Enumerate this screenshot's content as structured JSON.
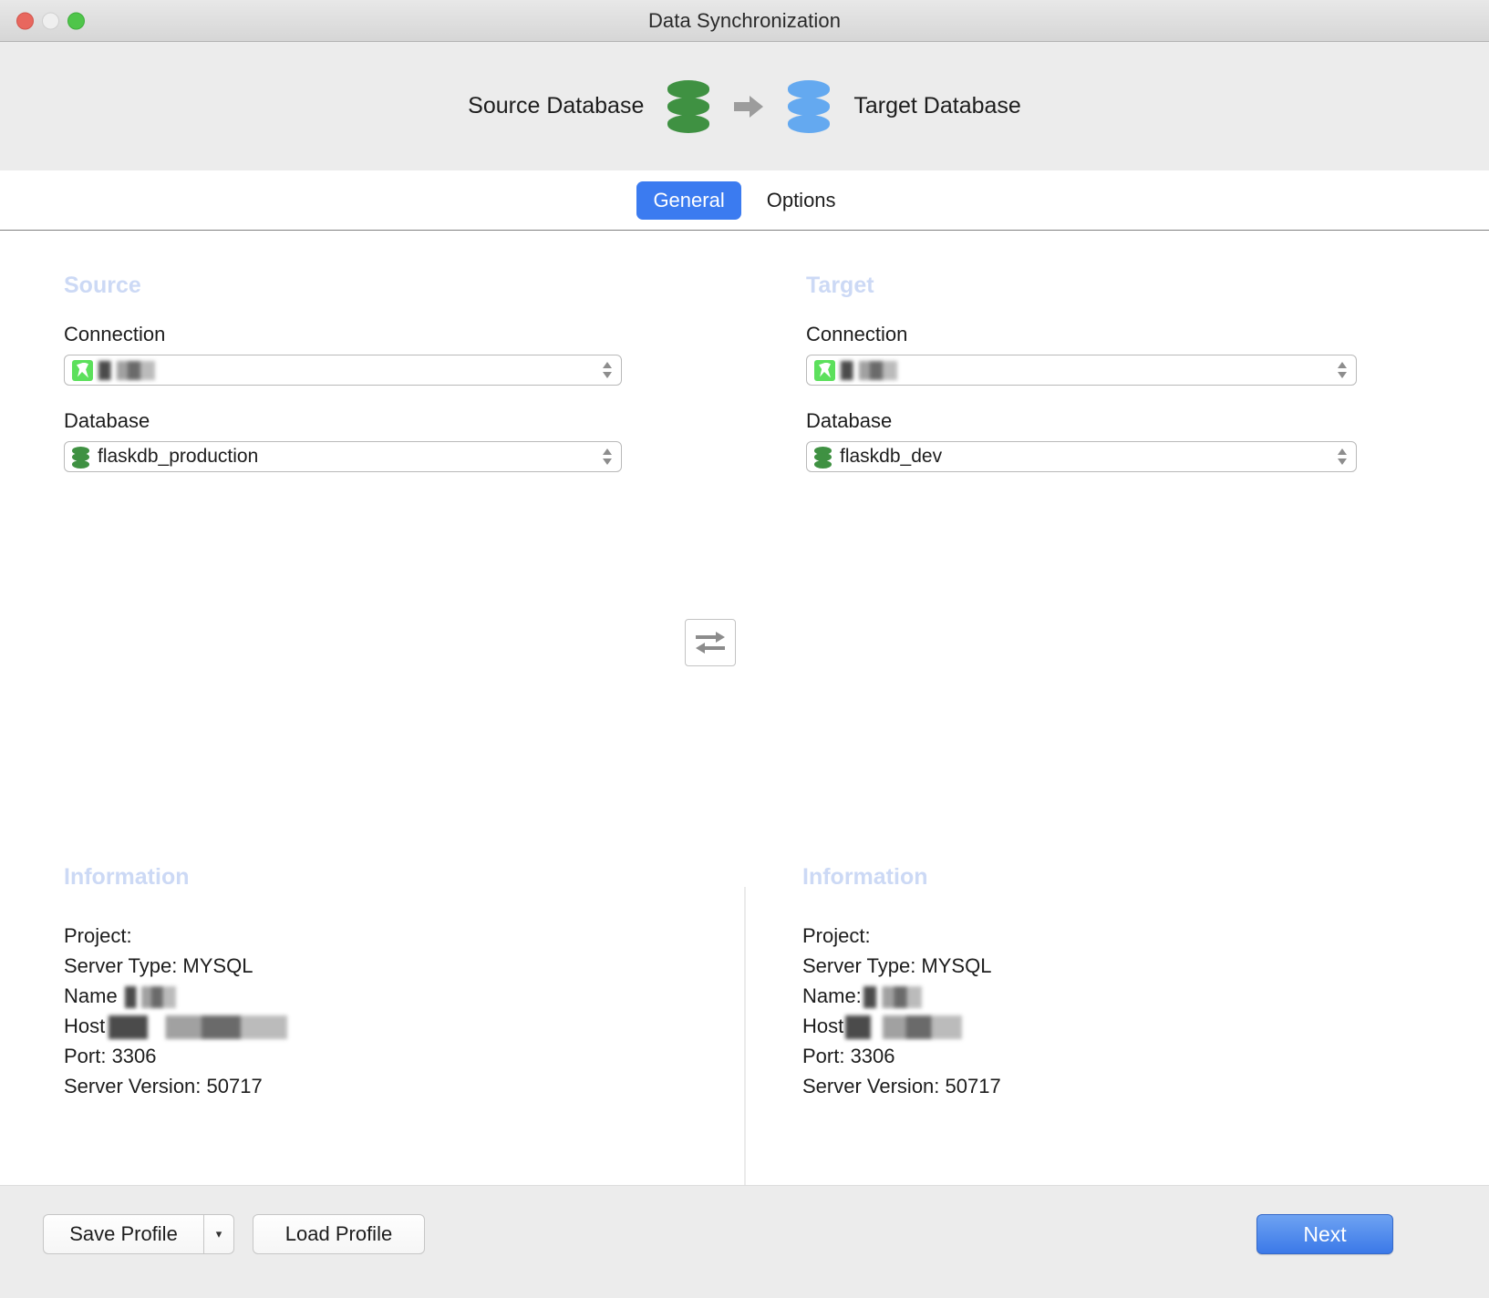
{
  "window": {
    "title": "Data Synchronization",
    "traffic_lights": [
      "close-button",
      "minimize-button",
      "zoom-button"
    ]
  },
  "hero": {
    "source_label": "Source Database",
    "target_label": "Target Database",
    "source_icon": "database-cylinder-icon",
    "arrow_icon": "right-arrow-icon",
    "target_icon": "database-cylinder-icon",
    "source_color": "#3f9142",
    "target_color": "#64a9f0",
    "arrow_color": "#9c9c9c"
  },
  "tabs": [
    {
      "label": "General",
      "active": true
    },
    {
      "label": "Options",
      "active": false
    }
  ],
  "tab_accent_color": "#3b7bf0",
  "source": {
    "section_title": "Source",
    "connection_label": "Connection",
    "connection_value": "",
    "connection_icon": "mysql-connection-icon",
    "database_label": "Database",
    "database_value": "flaskdb_production",
    "database_icon": "database-cylinder-icon"
  },
  "target": {
    "section_title": "Target",
    "connection_label": "Connection",
    "connection_value": "",
    "connection_icon": "mysql-connection-icon",
    "database_label": "Database",
    "database_value": "flaskdb_dev",
    "database_icon": "database-cylinder-icon"
  },
  "swap_button": {
    "icon": "swap-arrows-icon",
    "tooltip": ""
  },
  "information_source": {
    "title": "Information",
    "project": "Project:",
    "server_type": "Server Type: MYSQL",
    "name": "Name",
    "host": "Host",
    "port": "Port: 3306",
    "server_version": "Server Version: 50717"
  },
  "information_target": {
    "title": "Information",
    "project": "Project:",
    "server_type": "Server Type: MYSQL",
    "name": "Name:",
    "host": "Host",
    "port": "Port: 3306",
    "server_version": "Server Version: 50717"
  },
  "section_heading_color": "#ccd9f5",
  "footer": {
    "save_profile": "Save Profile",
    "save_profile_arrow": "▾",
    "load_profile": "Load Profile",
    "next": "Next",
    "next_color": "#3b79e8"
  }
}
